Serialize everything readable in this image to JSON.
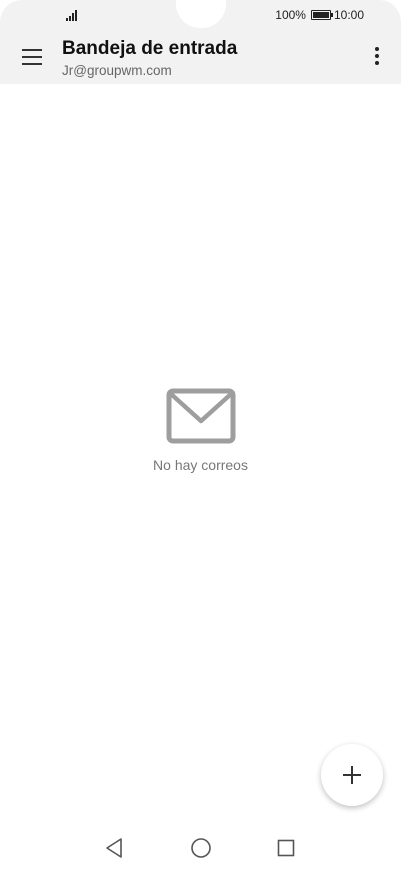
{
  "status_bar": {
    "battery_percent_label": "100%",
    "battery_level": 1.0,
    "time": "10:00",
    "signal_icon": "signal-icon",
    "battery_icon": "battery-icon"
  },
  "app_bar": {
    "title": "Bandeja de entrada",
    "account": "Jr@groupwm.com",
    "menu_icon": "hamburger-menu-icon",
    "more_icon": "more-vertical-icon"
  },
  "empty_state": {
    "icon": "envelope-icon",
    "message": "No hay correos"
  },
  "fab": {
    "icon": "plus-icon"
  },
  "nav_bar": {
    "back_icon": "triangle-back-icon",
    "home_icon": "circle-home-icon",
    "recent_icon": "square-recents-icon"
  },
  "colors": {
    "app_bar_background": "#f2f2f2",
    "page_background": "#ffffff",
    "icon_gray": "#9e9e9e",
    "text_dark": "#111111",
    "text_gray": "#666666"
  }
}
